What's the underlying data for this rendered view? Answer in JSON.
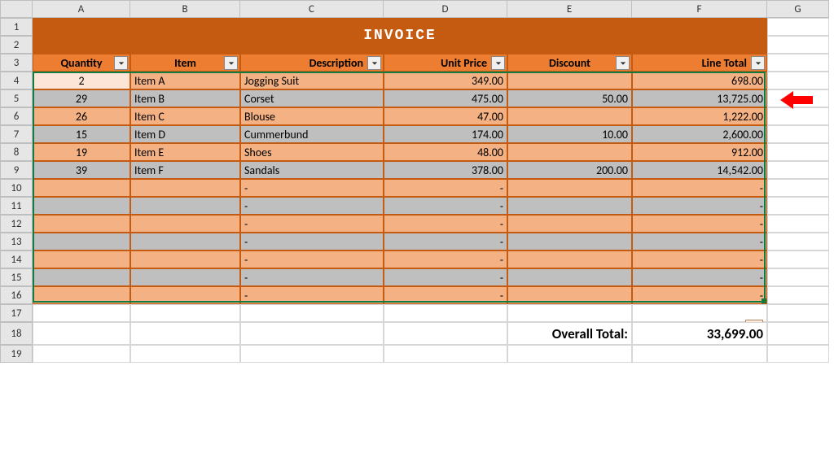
{
  "columns": [
    "A",
    "B",
    "C",
    "D",
    "E",
    "F",
    "G"
  ],
  "row_numbers": [
    1,
    2,
    3,
    4,
    5,
    6,
    7,
    8,
    9,
    10,
    11,
    12,
    13,
    14,
    15,
    16,
    17,
    18,
    19
  ],
  "invoice_title": "INVOICE",
  "headers": {
    "quantity": "Quantity",
    "item": "Item",
    "description": "Description",
    "unit_price": "Unit Price",
    "discount": "Discount",
    "line_total": "Line Total"
  },
  "rows": [
    {
      "row": 4,
      "qty": "2",
      "item": "Item A",
      "desc": "Jogging Suit",
      "unit": "349.00",
      "disc": "",
      "line": "698.00",
      "shade": "light",
      "a4": true
    },
    {
      "row": 5,
      "qty": "29",
      "item": "Item B",
      "desc": "Corset",
      "unit": "475.00",
      "disc": "50.00",
      "line": "13,725.00",
      "shade": "dark"
    },
    {
      "row": 6,
      "qty": "26",
      "item": "Item C",
      "desc": "Blouse",
      "unit": "47.00",
      "disc": "",
      "line": "1,222.00",
      "shade": "light"
    },
    {
      "row": 7,
      "qty": "15",
      "item": "Item D",
      "desc": "Cummerbund",
      "unit": "174.00",
      "disc": "10.00",
      "line": "2,600.00",
      "shade": "dark"
    },
    {
      "row": 8,
      "qty": "19",
      "item": "Item E",
      "desc": "Shoes",
      "unit": "48.00",
      "disc": "",
      "line": "912.00",
      "shade": "light"
    },
    {
      "row": 9,
      "qty": "39",
      "item": "Item F",
      "desc": "Sandals",
      "unit": "378.00",
      "disc": "200.00",
      "line": "14,542.00",
      "shade": "dark"
    },
    {
      "row": 10,
      "qty": "",
      "item": "",
      "desc": "-",
      "unit": "-",
      "disc": "",
      "line": "-",
      "shade": "light"
    },
    {
      "row": 11,
      "qty": "",
      "item": "",
      "desc": "-",
      "unit": "-",
      "disc": "",
      "line": "-",
      "shade": "dark"
    },
    {
      "row": 12,
      "qty": "",
      "item": "",
      "desc": "-",
      "unit": "-",
      "disc": "",
      "line": "-",
      "shade": "light"
    },
    {
      "row": 13,
      "qty": "",
      "item": "",
      "desc": "-",
      "unit": "-",
      "disc": "",
      "line": "-",
      "shade": "dark"
    },
    {
      "row": 14,
      "qty": "",
      "item": "",
      "desc": "-",
      "unit": "-",
      "disc": "",
      "line": "-",
      "shade": "light"
    },
    {
      "row": 15,
      "qty": "",
      "item": "",
      "desc": "-",
      "unit": "-",
      "disc": "",
      "line": "-",
      "shade": "dark"
    },
    {
      "row": 16,
      "qty": "",
      "item": "",
      "desc": "-",
      "unit": "-",
      "disc": "",
      "line": "-",
      "shade": "light"
    }
  ],
  "overall": {
    "label": "Overall Total:",
    "value": "33,699.00"
  },
  "selection": {
    "from_row": 4,
    "to_row": 16,
    "from_col": "A",
    "to_col": "F"
  }
}
